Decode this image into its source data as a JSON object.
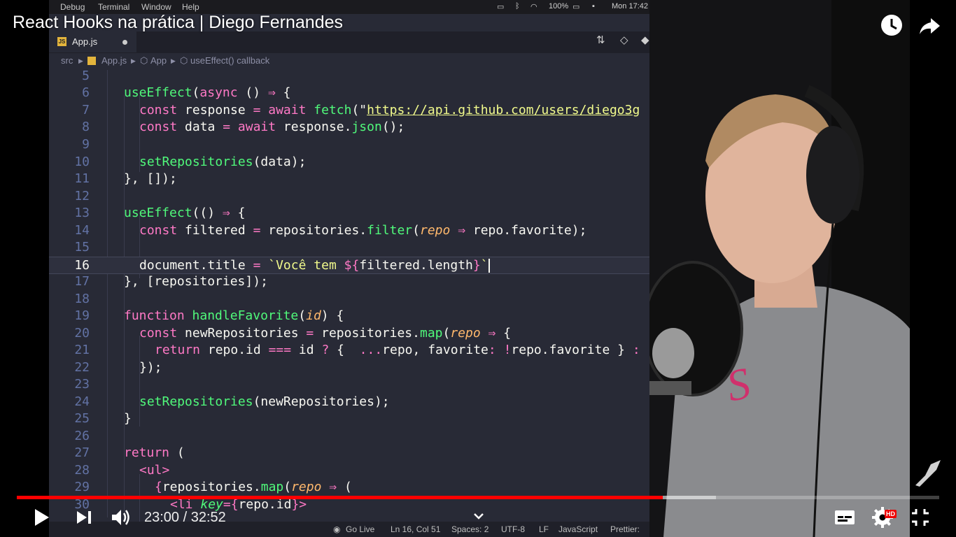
{
  "player": {
    "title": "React Hooks na prática | Diego Fernandes",
    "current_time": "23:00",
    "duration": "32:52",
    "time_display": "23:00 / 32:52",
    "progress_fraction": 0.7,
    "buffer_fraction": 0.758,
    "accent_color": "#ff0000",
    "hd_badge": "HD",
    "icons": [
      "watch-later-icon",
      "share-icon",
      "play-icon",
      "next-icon",
      "volume-icon",
      "chevron-down-icon",
      "subtitles-icon",
      "settings-icon",
      "exit-fullscreen-icon",
      "channel-watermark-icon"
    ]
  },
  "menubar": {
    "items": [
      "Debug",
      "Terminal",
      "Window",
      "Help"
    ],
    "battery": "100%",
    "clock": "Mon 17:42"
  },
  "editor": {
    "tab": {
      "label": "App.js",
      "badge": "JS"
    },
    "breadcrumb": [
      "src",
      "App.js",
      "App",
      "useEffect() callback"
    ],
    "current_line": 16,
    "lines": [
      {
        "n": "5"
      },
      {
        "n": "6"
      },
      {
        "n": "7"
      },
      {
        "n": "8"
      },
      {
        "n": "9"
      },
      {
        "n": "10"
      },
      {
        "n": "11"
      },
      {
        "n": "12"
      },
      {
        "n": "13"
      },
      {
        "n": "14"
      },
      {
        "n": "15"
      },
      {
        "n": "16"
      },
      {
        "n": "17"
      },
      {
        "n": "18"
      },
      {
        "n": "19"
      },
      {
        "n": "20"
      },
      {
        "n": "21"
      },
      {
        "n": "22"
      },
      {
        "n": "23"
      },
      {
        "n": "24"
      },
      {
        "n": "25"
      },
      {
        "n": "26"
      },
      {
        "n": "27"
      },
      {
        "n": "28"
      },
      {
        "n": "29"
      },
      {
        "n": "30"
      }
    ],
    "code": {
      "l6": [
        "useEffect",
        "(",
        "async",
        " () ",
        "⇒",
        " {"
      ],
      "l7": [
        "const",
        " response ",
        "=",
        " ",
        "await",
        " ",
        "fetch",
        "(\"",
        "https://api.github.com/users/diego3g"
      ],
      "l8": [
        "const",
        " data ",
        "=",
        " ",
        "await",
        " response.",
        "json",
        "();"
      ],
      "l10": [
        "setRepositories",
        "(data);"
      ],
      "l11": [
        "}, []);"
      ],
      "l13": [
        "useEffect",
        "(() ",
        "⇒",
        " {"
      ],
      "l14": [
        "const",
        " filtered ",
        "=",
        " repositories.",
        "filter",
        "(",
        "repo",
        " ",
        "⇒",
        " repo.favorite);"
      ],
      "l16": [
        "document.title ",
        "=",
        " `",
        "Você tem ",
        "${",
        "filtered.length",
        "}",
        "`"
      ],
      "l17": [
        "}, [repositories]);"
      ],
      "l19": [
        "function",
        " ",
        "handleFavorite",
        "(",
        "id",
        ") {"
      ],
      "l20": [
        "const",
        " newRepositories ",
        "=",
        " repositories.",
        "map",
        "(",
        "repo",
        " ",
        "⇒",
        " {"
      ],
      "l21": [
        "return",
        " repo.id ",
        "===",
        " id ",
        "?",
        " {  ",
        "...",
        "repo, favorite",
        ":",
        " ",
        "!",
        "repo.favorite } ",
        ":"
      ],
      "l22": [
        "});"
      ],
      "l24": [
        "setRepositories",
        "(newRepositories);"
      ],
      "l25": [
        "}"
      ],
      "l27": [
        "return",
        " ("
      ],
      "l28": [
        "<",
        "ul",
        ">"
      ],
      "l29": [
        "{",
        "repositories.",
        "map",
        "(",
        "repo",
        " ",
        "⇒",
        " ("
      ],
      "l30": [
        "<",
        "li",
        " ",
        "key",
        "=",
        "{",
        "repo.id",
        "}",
        ">"
      ]
    },
    "statusbar": {
      "go_live": "Go Live",
      "position": "Ln 16, Col 51",
      "spaces": "Spaces: 2",
      "encoding": "UTF-8",
      "eol": "LF",
      "language": "JavaScript",
      "formatter": "Prettier:"
    }
  }
}
